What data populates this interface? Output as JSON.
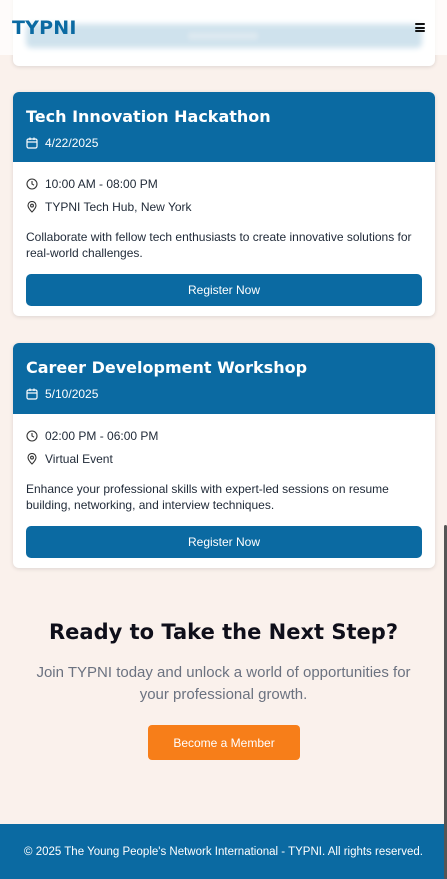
{
  "header": {
    "logo": "TYPNI",
    "menu_icon": "hamburger-menu-icon"
  },
  "events": [
    {
      "title": "Tech Innovation Hackathon",
      "date": "4/22/2025",
      "time": "10:00 AM - 08:00 PM",
      "location": "TYPNI Tech Hub, New York",
      "description": "Collaborate with fellow tech enthusiasts to create innovative solutions for real-world challenges.",
      "button": "Register Now"
    },
    {
      "title": "Career Development Workshop",
      "date": "5/10/2025",
      "time": "02:00 PM - 06:00 PM",
      "location": "Virtual Event",
      "description": "Enhance your professional skills with expert-led sessions on resume building, networking, and interview techniques.",
      "button": "Register Now"
    }
  ],
  "cta": {
    "title": "Ready to Take the Next Step?",
    "text": "Join TYPNI today and unlock a world of opportunities for your professional growth.",
    "button": "Become a Member"
  },
  "footer": {
    "text": "© 2025 The Young People's Network International - TYPNI. All rights reserved."
  },
  "colors": {
    "primary": "#0b6aa2",
    "accent": "#f77e19",
    "background": "#faf1ec"
  }
}
